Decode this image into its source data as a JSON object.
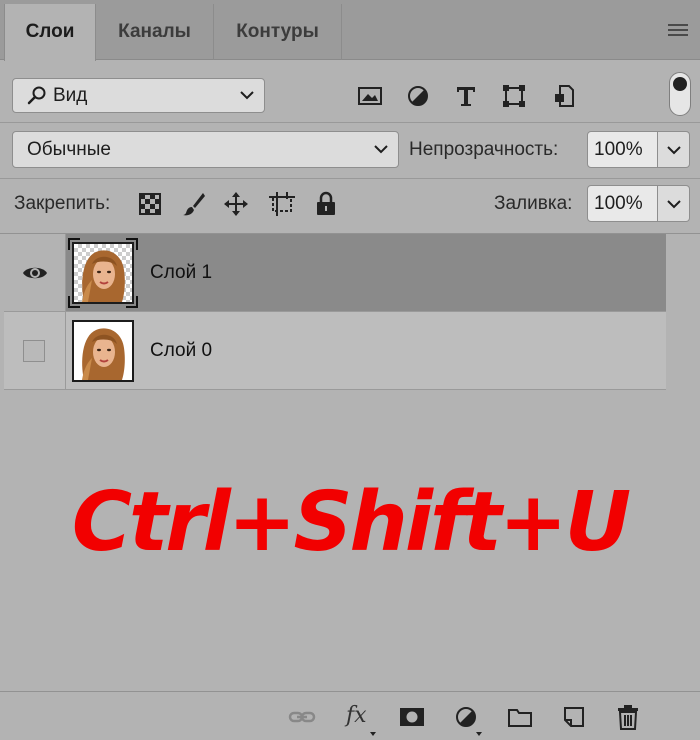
{
  "tabs": [
    {
      "label": "Слои",
      "active": true
    },
    {
      "label": "Каналы",
      "active": false
    },
    {
      "label": "Контуры",
      "active": false
    }
  ],
  "filter": {
    "value": "Вид",
    "icons": [
      "image-filter-icon",
      "adjustment-filter-icon",
      "type-filter-icon",
      "shape-filter-icon",
      "smart-object-filter-icon"
    ]
  },
  "blend": {
    "mode": "Обычные",
    "opacity_label": "Непрозрачность:",
    "opacity_value": "100%"
  },
  "lock": {
    "label": "Закрепить:",
    "fill_label": "Заливка:",
    "fill_value": "100%"
  },
  "layers": [
    {
      "name": "Слой 1",
      "visible": true,
      "selected": true
    },
    {
      "name": "Слой 0",
      "visible": false,
      "selected": false
    }
  ],
  "overlay_text": "Ctrl+Shift+U",
  "colors": {
    "overlay": "#f20000",
    "panel": "#b3b3b3",
    "selected_row": "#8a8a8a"
  }
}
